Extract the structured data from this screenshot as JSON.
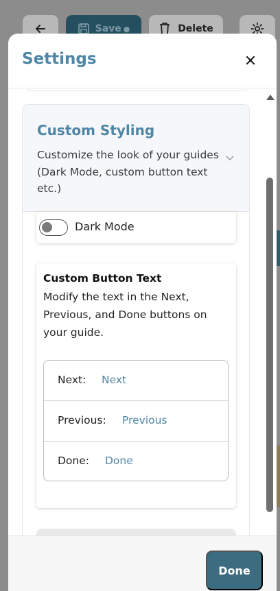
{
  "background_toolbar": {
    "save_label": "Save",
    "save_indicator": "●",
    "delete_label": "Delete",
    "icons": [
      "arrow-left-icon",
      "save-icon",
      "trash-icon",
      "gear-icon"
    ]
  },
  "modal": {
    "title": "Settings",
    "section": {
      "title": "Custom Styling",
      "description": "Customize the look of your guides (Dark Mode, custom button text etc.)",
      "dark_mode": {
        "label": "Dark Mode",
        "enabled": false
      },
      "custom_button_text": {
        "title": "Custom Button Text",
        "description": "Modify the text in the Next, Previous, and Done buttons on your guide.",
        "fields": [
          {
            "label": "Next:",
            "value": "Next"
          },
          {
            "label": "Previous:",
            "value": "Previous"
          },
          {
            "label": "Done:",
            "value": "Done"
          }
        ]
      }
    },
    "footer": {
      "done_label": "Done"
    }
  },
  "colors": {
    "accent": "#4e86a6",
    "primary_button": "#3b6c80",
    "overlay": "#8c8c8c"
  }
}
